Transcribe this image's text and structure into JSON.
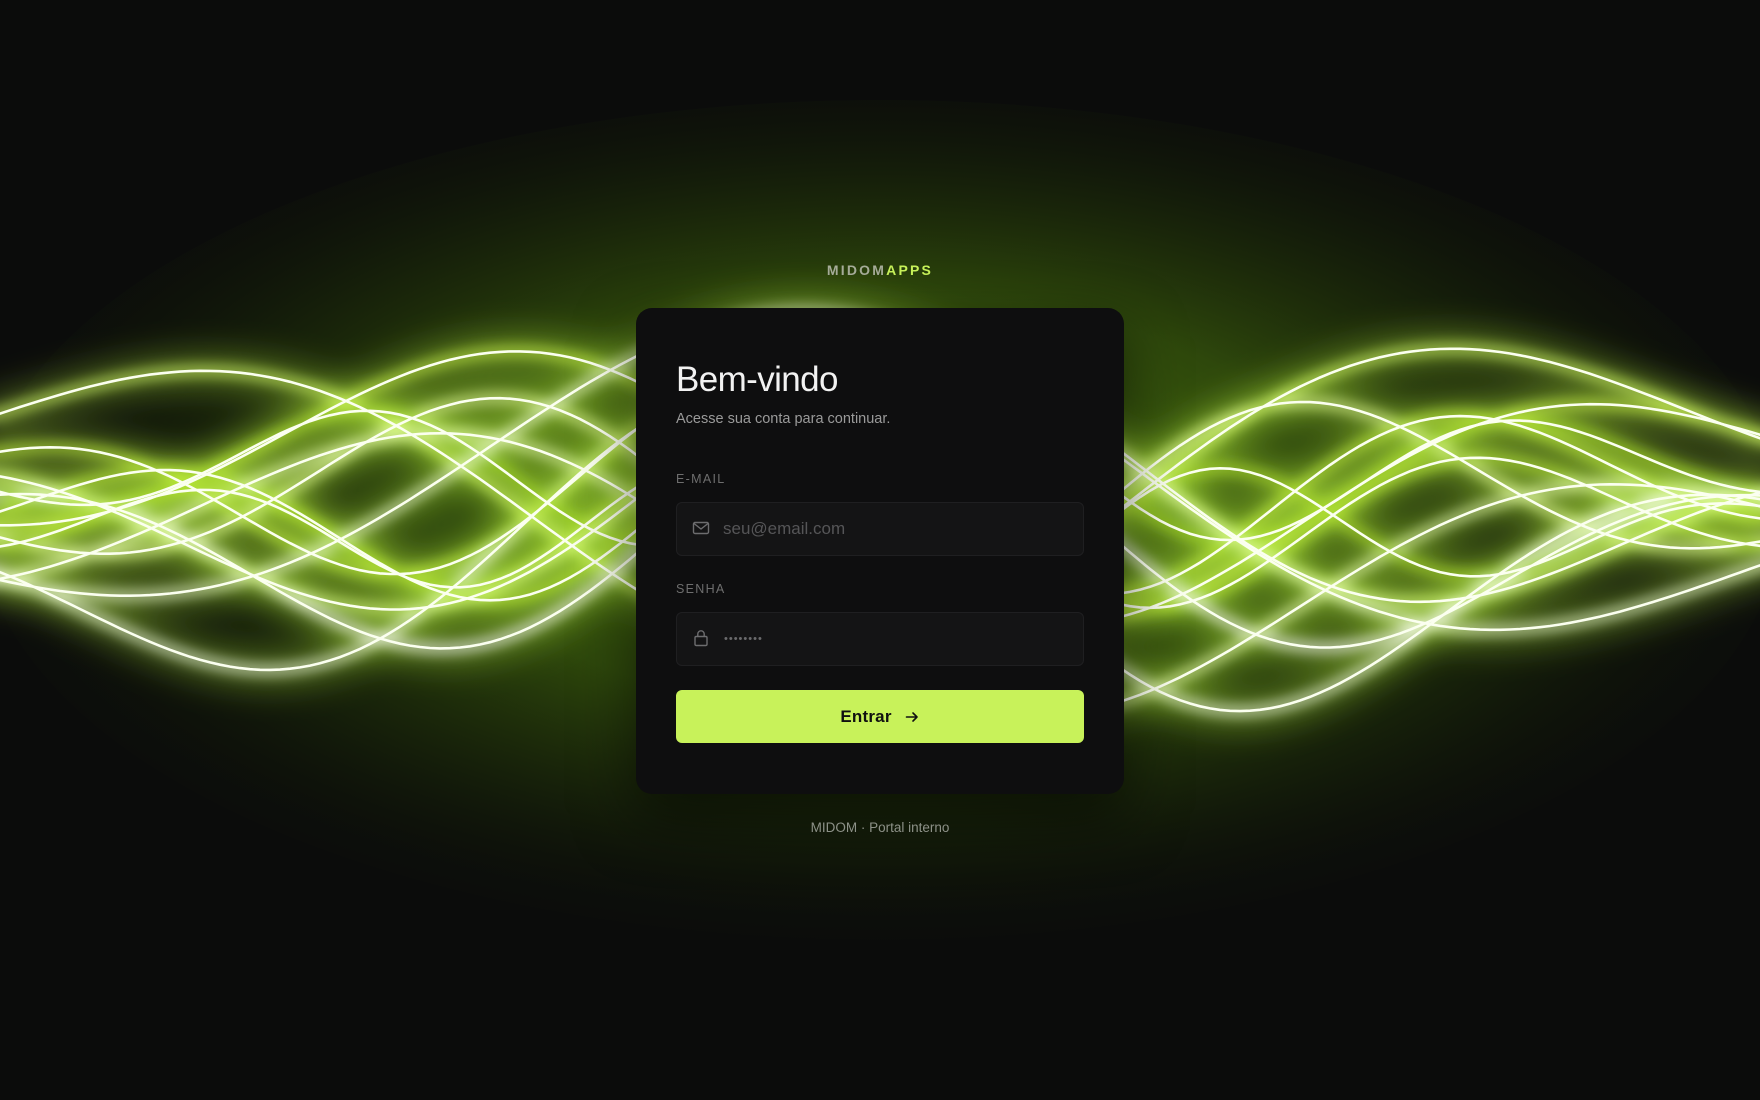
{
  "brand": {
    "part1": "MIDOM",
    "part2": "APPS"
  },
  "login": {
    "title": "Bem-vindo",
    "subtitle": "Acesse sua conta para continuar.",
    "email": {
      "label": "E-MAIL",
      "placeholder": "seu@email.com",
      "icon": "mail-icon"
    },
    "password": {
      "label": "SENHA",
      "value_masked": "••••••••",
      "icon": "lock-icon"
    },
    "submit_label": "Entrar",
    "submit_icon": "arrow-right-icon"
  },
  "footer": {
    "text": "MIDOM · Portal interno"
  },
  "colors": {
    "accent": "#c8f25a",
    "card": "#0e0e0f",
    "background": "#0b0c0b"
  }
}
